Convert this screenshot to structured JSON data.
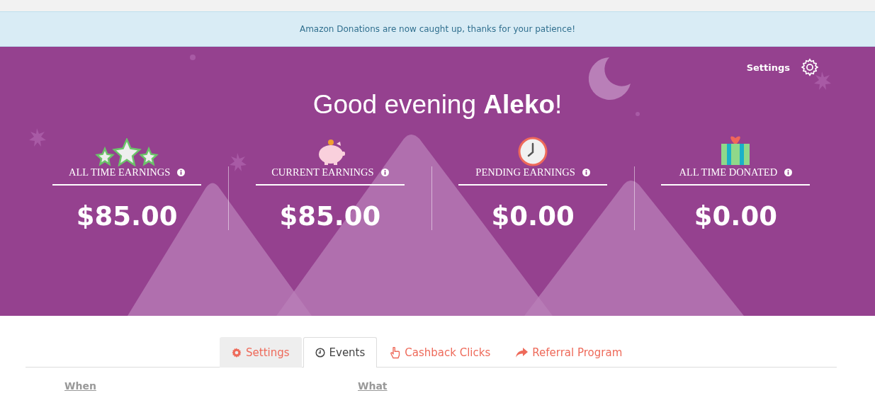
{
  "banner": {
    "message": "Amazon Donations are now caught up, thanks for your patience!"
  },
  "header": {
    "settings_label": "Settings",
    "greeting": "Good evening **Aleko**!"
  },
  "stats": [
    {
      "kind": "stars",
      "label": "ALL TIME EARNINGS",
      "amount": "$85.00"
    },
    {
      "kind": "piggy",
      "label": "CURRENT EARNINGS",
      "amount": "$85.00"
    },
    {
      "kind": "clock",
      "label": "PENDING EARNINGS",
      "amount": "$0.00"
    },
    {
      "kind": "gift",
      "label": "ALL TIME DONATED",
      "amount": "$0.00"
    }
  ],
  "tabs": [
    {
      "kind": "gear",
      "label": "Settings",
      "selected": false,
      "highlighted": true
    },
    {
      "kind": "clock",
      "label": "Events",
      "selected": true,
      "highlighted": false
    },
    {
      "kind": "hand",
      "label": "Cashback Clicks",
      "selected": false,
      "highlighted": false
    },
    {
      "kind": "share",
      "label": "Referral Program",
      "selected": false,
      "highlighted": false
    }
  ],
  "table": {
    "columns": [
      "When",
      "What"
    ]
  }
}
